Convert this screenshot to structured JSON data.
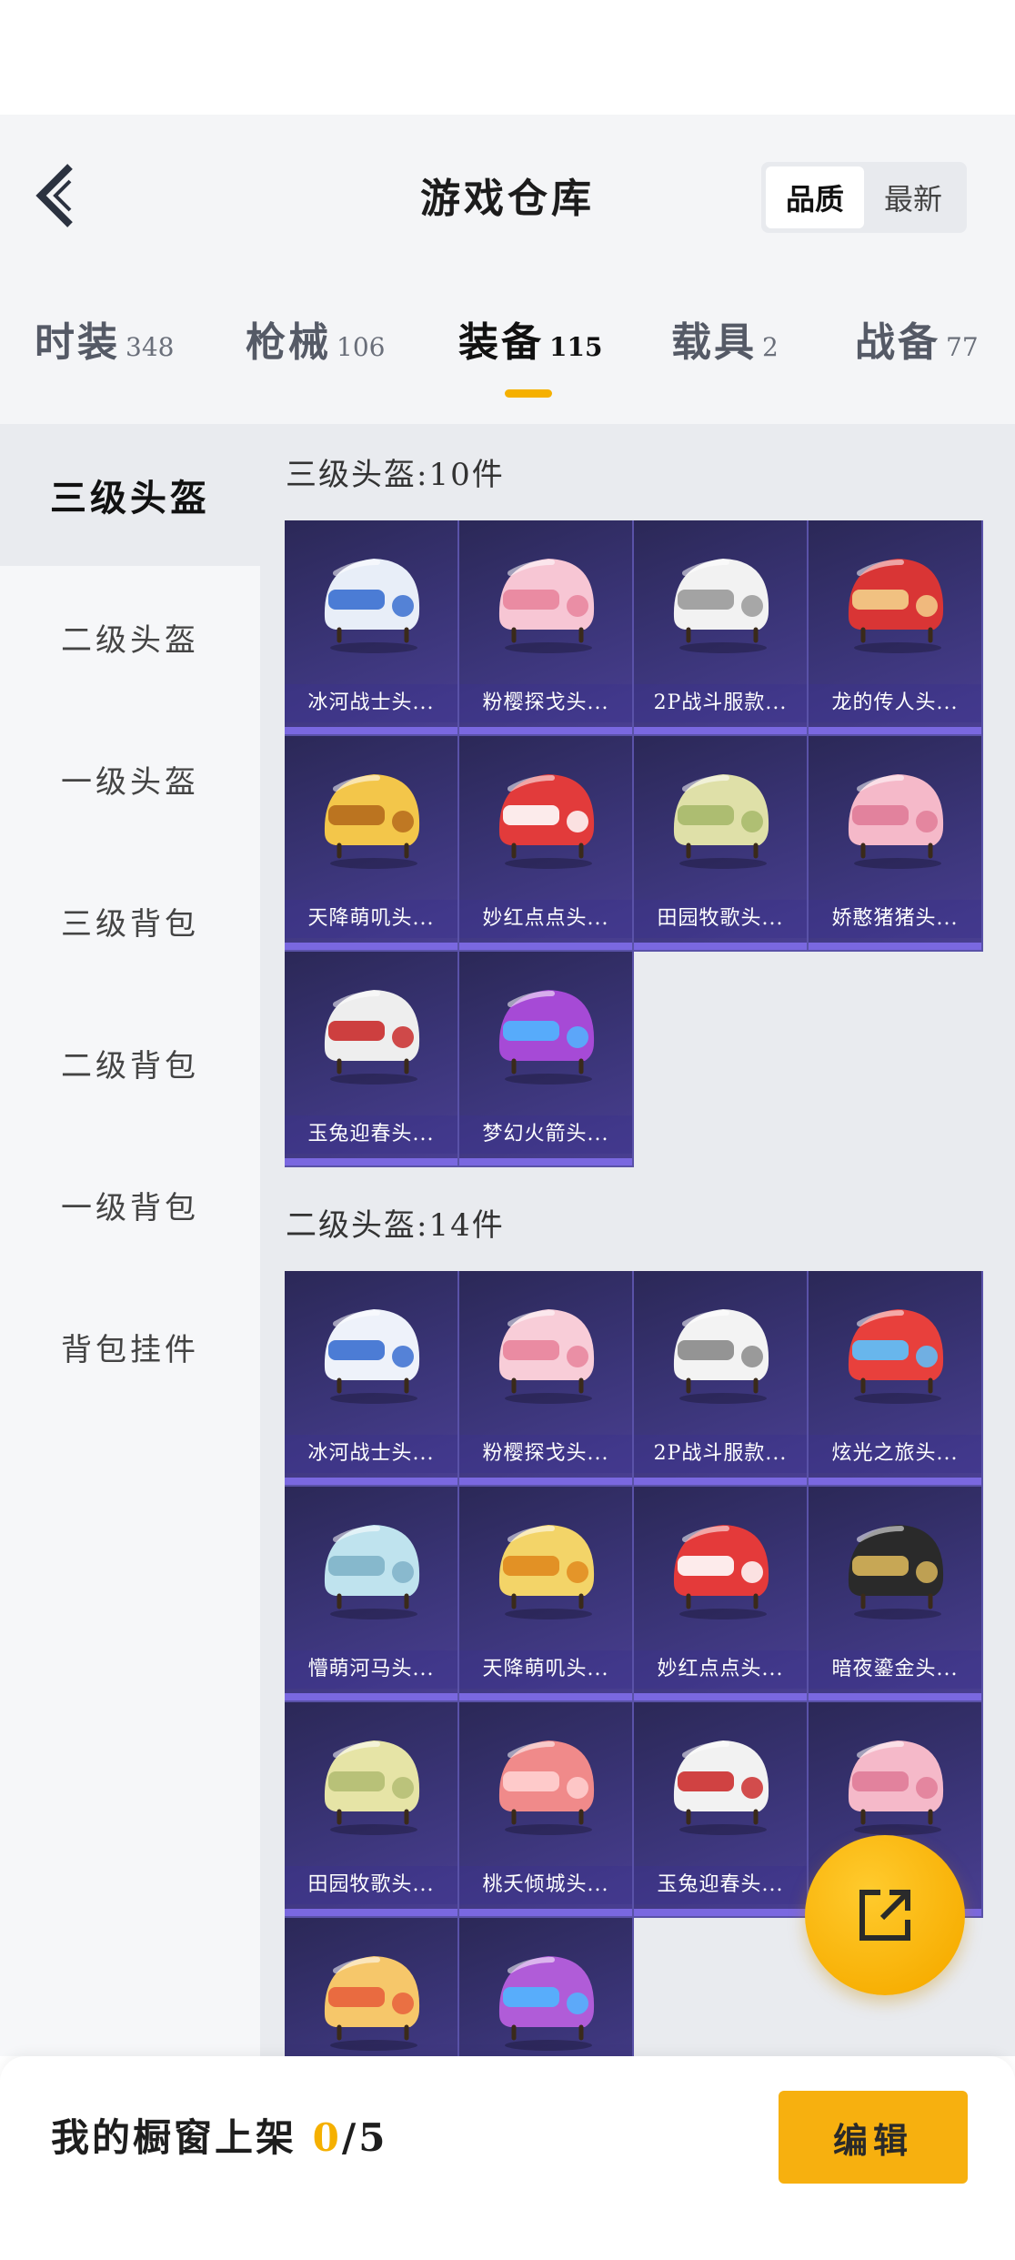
{
  "header": {
    "title": "游戏仓库",
    "sort_options": [
      "品质",
      "最新"
    ],
    "sort_active": "品质"
  },
  "tabs": [
    {
      "label": "时装",
      "count": "348"
    },
    {
      "label": "枪械",
      "count": "106"
    },
    {
      "label": "装备",
      "count": "115"
    },
    {
      "label": "载具",
      "count": "2"
    },
    {
      "label": "战备",
      "count": "77"
    }
  ],
  "active_tab": "装备",
  "sidebar": {
    "items": [
      "三级头盔",
      "二级头盔",
      "一级头盔",
      "三级背包",
      "二级背包",
      "一级背包",
      "背包挂件"
    ],
    "active": "三级头盔"
  },
  "sections": [
    {
      "title": "三级头盔:10件",
      "items": [
        {
          "name": "冰河战士头...",
          "icon": "helmet-icon",
          "color": "#e8eef8",
          "accent": "#3a6fd0"
        },
        {
          "name": "粉樱探戈头...",
          "icon": "helmet-icon",
          "color": "#f7c6d4",
          "accent": "#e8849c"
        },
        {
          "name": "2P战斗服款...",
          "icon": "helmet-icon",
          "color": "#f2f2f2",
          "accent": "#9a9a9a"
        },
        {
          "name": "龙的传人头...",
          "icon": "helmet-icon",
          "color": "#d93535",
          "accent": "#f3d08a"
        },
        {
          "name": "天降萌叽头...",
          "icon": "helmet-icon",
          "color": "#f3c64a",
          "accent": "#b56a1c"
        },
        {
          "name": "妙红点点头...",
          "icon": "helmet-icon",
          "color": "#e23b3b",
          "accent": "#ffffff"
        },
        {
          "name": "田园牧歌头...",
          "icon": "helmet-icon",
          "color": "#dfe0a8",
          "accent": "#a7b96a"
        },
        {
          "name": "娇憨猪猪头...",
          "icon": "helmet-icon",
          "color": "#f5b9c9",
          "accent": "#e07c98"
        },
        {
          "name": "玉兔迎春头...",
          "icon": "helmet-icon",
          "color": "#eeeeee",
          "accent": "#c92b2b"
        },
        {
          "name": "梦幻火箭头...",
          "icon": "helmet-icon",
          "color": "#a64ad6",
          "accent": "#4fb6ff"
        }
      ]
    },
    {
      "title": "二级头盔:14件",
      "items": [
        {
          "name": "冰河战士头...",
          "icon": "helmet-icon",
          "color": "#eef2fa",
          "accent": "#3a6fd0"
        },
        {
          "name": "粉樱探戈头...",
          "icon": "helmet-icon",
          "color": "#f8cdd8",
          "accent": "#e8849c"
        },
        {
          "name": "2P战斗服款...",
          "icon": "helmet-icon",
          "color": "#f3f3f3",
          "accent": "#8a8a8a"
        },
        {
          "name": "炫光之旅头...",
          "icon": "helmet-icon",
          "color": "#e8403c",
          "accent": "#5ac3ff"
        },
        {
          "name": "懵萌河马头...",
          "icon": "helmet-icon",
          "color": "#bfe3ee",
          "accent": "#7fb2c8"
        },
        {
          "name": "天降萌叽头...",
          "icon": "helmet-icon",
          "color": "#f3d468",
          "accent": "#e08a1e"
        },
        {
          "name": "妙红点点头...",
          "icon": "helmet-icon",
          "color": "#e43a3a",
          "accent": "#ffffff"
        },
        {
          "name": "暗夜鎏金头...",
          "icon": "helmet-icon",
          "color": "#2a2a2a",
          "accent": "#d8b55a"
        },
        {
          "name": "田园牧歌头...",
          "icon": "helmet-icon",
          "color": "#e6e4a6",
          "accent": "#b3bd73"
        },
        {
          "name": "桃夭倾城头...",
          "icon": "helmet-icon",
          "color": "#f08a8a",
          "accent": "#ffd0d0"
        },
        {
          "name": "玉兔迎春头...",
          "icon": "helmet-icon",
          "color": "#f2f2f2",
          "accent": "#cc2f2f"
        },
        {
          "name": "",
          "icon": "helmet-icon",
          "color": "#f5b9c9",
          "accent": "#e07c98"
        },
        {
          "name": "",
          "icon": "helmet-icon",
          "color": "#f6c76a",
          "accent": "#e8603c"
        },
        {
          "name": "",
          "icon": "helmet-icon",
          "color": "#b05cd8",
          "accent": "#4fb6ff"
        }
      ]
    }
  ],
  "bottom": {
    "label": "我的橱窗上架",
    "current": "0",
    "total": "/5",
    "edit_label": "编辑"
  }
}
